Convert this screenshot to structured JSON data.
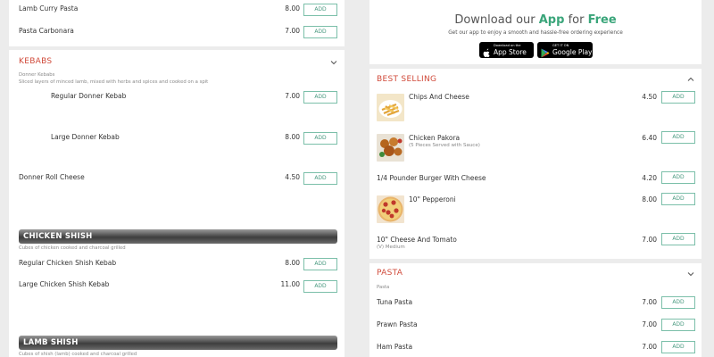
{
  "left": {
    "top_items": [
      {
        "name": "Lamb Curry Pasta",
        "price": "8.00"
      },
      {
        "name": "Pasta Carbonara",
        "price": "7.00"
      }
    ],
    "kebabs": {
      "title": "KEBABS",
      "subtitle": "Donner Kebabs",
      "description": "Sliced layers of minced lamb, mixed with herbs and spices and cooked on a spit",
      "items": [
        {
          "name": "Regular Donner Kebab",
          "price": "7.00"
        },
        {
          "name": "Large Donner Kebab",
          "price": "8.00"
        },
        {
          "name": "Donner Roll Cheese",
          "price": "4.50"
        }
      ]
    },
    "chicken_shish": {
      "title": "CHICKEN SHISH",
      "description": "Cubes of chicken cooked and charcoal grilled",
      "items": [
        {
          "name": "Regular Chicken Shish Kebab",
          "price": "8.00"
        },
        {
          "name": "Large Chicken Shish Kebab",
          "price": "11.00"
        }
      ]
    },
    "lamb_shish": {
      "title": "LAMB SHISH",
      "description": "Cubes of shish (lamb) cooked and charcoal grilled"
    }
  },
  "right": {
    "app": {
      "title_plain": "Download our ",
      "title_accent": "App",
      "title_mid": " for ",
      "title_end": "Free",
      "subtitle": "Get our app to enjoy a smooth and hassle-free ordering experience",
      "appstore_small": "Download on the",
      "appstore_big": "App Store",
      "play_small": "GET IT ON",
      "play_big": "Google Play",
      "accent_color": "#3aa57a"
    },
    "best_selling": {
      "title": "BEST SELLING",
      "items": [
        {
          "name": "Chips And Cheese",
          "price": "4.50",
          "note": ""
        },
        {
          "name": "Chicken Pakora",
          "price": "6.40",
          "note": "(5 Pieces Served with Sauce)"
        },
        {
          "name": "1/4 Pounder Burger With Cheese",
          "price": "4.20",
          "note": ""
        },
        {
          "name": "10\" Pepperoni",
          "price": "8.00",
          "note": ""
        },
        {
          "name": "10\" Cheese And Tomato",
          "price": "7.00",
          "note": "(V) Medium"
        }
      ]
    },
    "pasta": {
      "title": "PASTA",
      "subtitle": "Pasta",
      "items": [
        {
          "name": "Tuna Pasta",
          "price": "7.00"
        },
        {
          "name": "Prawn Pasta",
          "price": "7.00"
        },
        {
          "name": "Ham Pasta",
          "price": "7.00"
        }
      ]
    }
  },
  "add_label": "ADD",
  "colors": {
    "section_title": "#d04a3a",
    "button_border": "#7bbfa9",
    "button_text": "#4a9a80"
  }
}
